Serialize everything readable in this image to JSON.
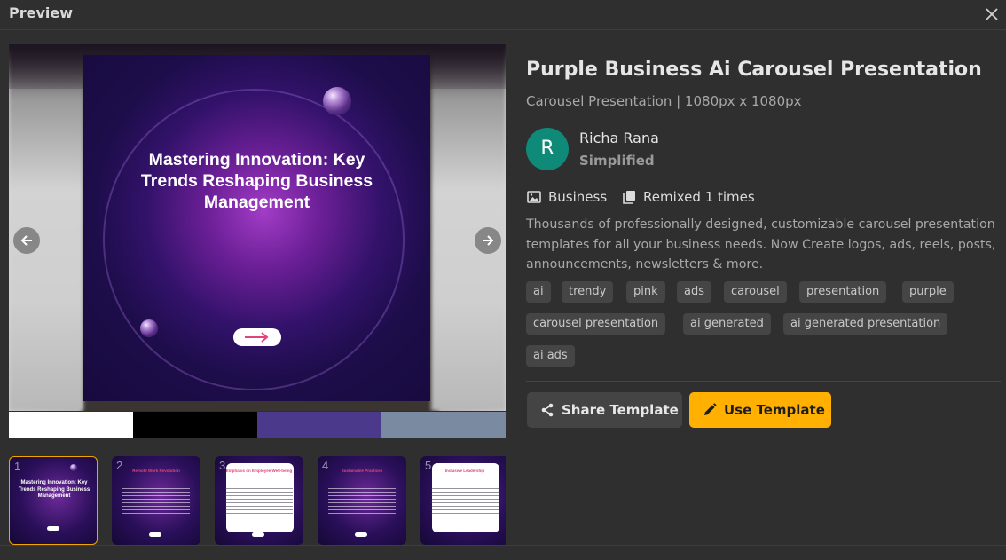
{
  "header": {
    "title": "Preview"
  },
  "template": {
    "title": "Purple Business Ai Carousel Presentation",
    "subtitle": "Carousel Presentation | 1080px x 1080px"
  },
  "author": {
    "initial": "R",
    "name": "Richa Rana",
    "org": "Simplified"
  },
  "meta": {
    "category": "Business",
    "remix": "Remixed 1 times"
  },
  "description": "Thousands of professionally designed, customizable carousel presentation templates for all your business needs. Now Create logos, ads, reels, posts, announcements, newsletters & more.",
  "tags": [
    "ai",
    "trendy",
    "pink",
    "ads",
    "carousel",
    "presentation",
    "purple",
    "carousel presentation",
    "ai generated",
    "ai generated presentation",
    "ai ads"
  ],
  "buttons": {
    "share": "Share Template",
    "use": "Use Template"
  },
  "slide": {
    "title": "Mastering Innovation: Key Trends Reshaping Business Management"
  },
  "palette": [
    "#ffffff",
    "#000000",
    "#4b3a8c",
    "#7a8aa0"
  ],
  "thumbnails": [
    {
      "number": "1",
      "title": "Mastering Innovation: Key Trends Reshaping Business Management"
    },
    {
      "number": "2",
      "title": "Remote Work Revolution"
    },
    {
      "number": "3",
      "title": "Emphasis on Employee Well-being"
    },
    {
      "number": "4",
      "title": "Sustainable Practices"
    },
    {
      "number": "5",
      "title": "Inclusive Leadership"
    }
  ],
  "colors": {
    "accent": "#ffb000",
    "avatar": "#0f8a78",
    "surface": "#2f2f2f",
    "tag": "#454545"
  },
  "icons": [
    "close-icon",
    "arrow-left-icon",
    "arrow-right-icon",
    "image-icon",
    "copy-icon",
    "share-icon",
    "pencil-icon"
  ]
}
